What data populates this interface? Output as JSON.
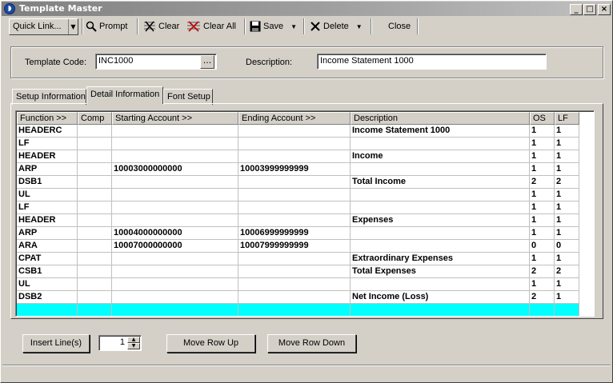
{
  "window": {
    "title": "Template Master",
    "controls": {
      "minimize": "_",
      "maximize": "□",
      "close": "×"
    }
  },
  "toolbar": {
    "quick_link": "Quick Link...",
    "prompt": "Prompt",
    "clear": "Clear",
    "clear_all": "Clear All",
    "save": "Save",
    "delete": "Delete",
    "close": "Close"
  },
  "header": {
    "template_code_label": "Template Code:",
    "template_code_value": "INC1000",
    "browse_button": "...",
    "description_label": "Description:",
    "description_value": "Income Statement 1000"
  },
  "tabs": [
    {
      "label": "Setup Information",
      "active": false
    },
    {
      "label": "Detail Information",
      "active": true
    },
    {
      "label": "Font Setup",
      "active": false
    }
  ],
  "grid": {
    "columns": [
      "Function >>",
      "Comp",
      "Starting Account >>",
      "Ending Account >>",
      "Description",
      "OS",
      "LF"
    ],
    "rows": [
      [
        "HEADERC",
        "",
        "",
        "",
        "Income Statement 1000",
        "1",
        "1"
      ],
      [
        "LF",
        "",
        "",
        "",
        "",
        "1",
        "1"
      ],
      [
        "HEADER",
        "",
        "",
        "",
        "Income",
        "1",
        "1"
      ],
      [
        "ARP",
        "",
        "10003000000000",
        "10003999999999",
        "",
        "1",
        "1"
      ],
      [
        "DSB1",
        "",
        "",
        "",
        "Total Income",
        "2",
        "2"
      ],
      [
        "UL",
        "",
        "",
        "",
        "",
        "1",
        "1"
      ],
      [
        "LF",
        "",
        "",
        "",
        "",
        "1",
        "1"
      ],
      [
        "HEADER",
        "",
        "",
        "",
        "Expenses",
        "1",
        "1"
      ],
      [
        "ARP",
        "",
        "10004000000000",
        "10006999999999",
        "",
        "1",
        "1"
      ],
      [
        "ARA",
        "",
        "10007000000000",
        "10007999999999",
        "",
        "0",
        "0"
      ],
      [
        "CPAT",
        "",
        "",
        "",
        "Extraordinary Expenses",
        "1",
        "1"
      ],
      [
        "CSB1",
        "",
        "",
        "",
        "Total Expenses",
        "2",
        "2"
      ],
      [
        "UL",
        "",
        "",
        "",
        "",
        "1",
        "1"
      ],
      [
        "DSB2",
        "",
        "",
        "",
        "Net Income (Loss)",
        "2",
        "1"
      ],
      [
        "",
        "",
        "",
        "",
        "",
        "",
        ""
      ]
    ],
    "new_row_color": "#00ffff"
  },
  "footer": {
    "insert_lines": "Insert Line(s)",
    "insert_count": "1",
    "move_up": "Move Row Up",
    "move_down": "Move Row Down"
  },
  "colors": {
    "title_bar": "#808080",
    "face": "#d4d0c8",
    "new_row": "#00ffff"
  }
}
